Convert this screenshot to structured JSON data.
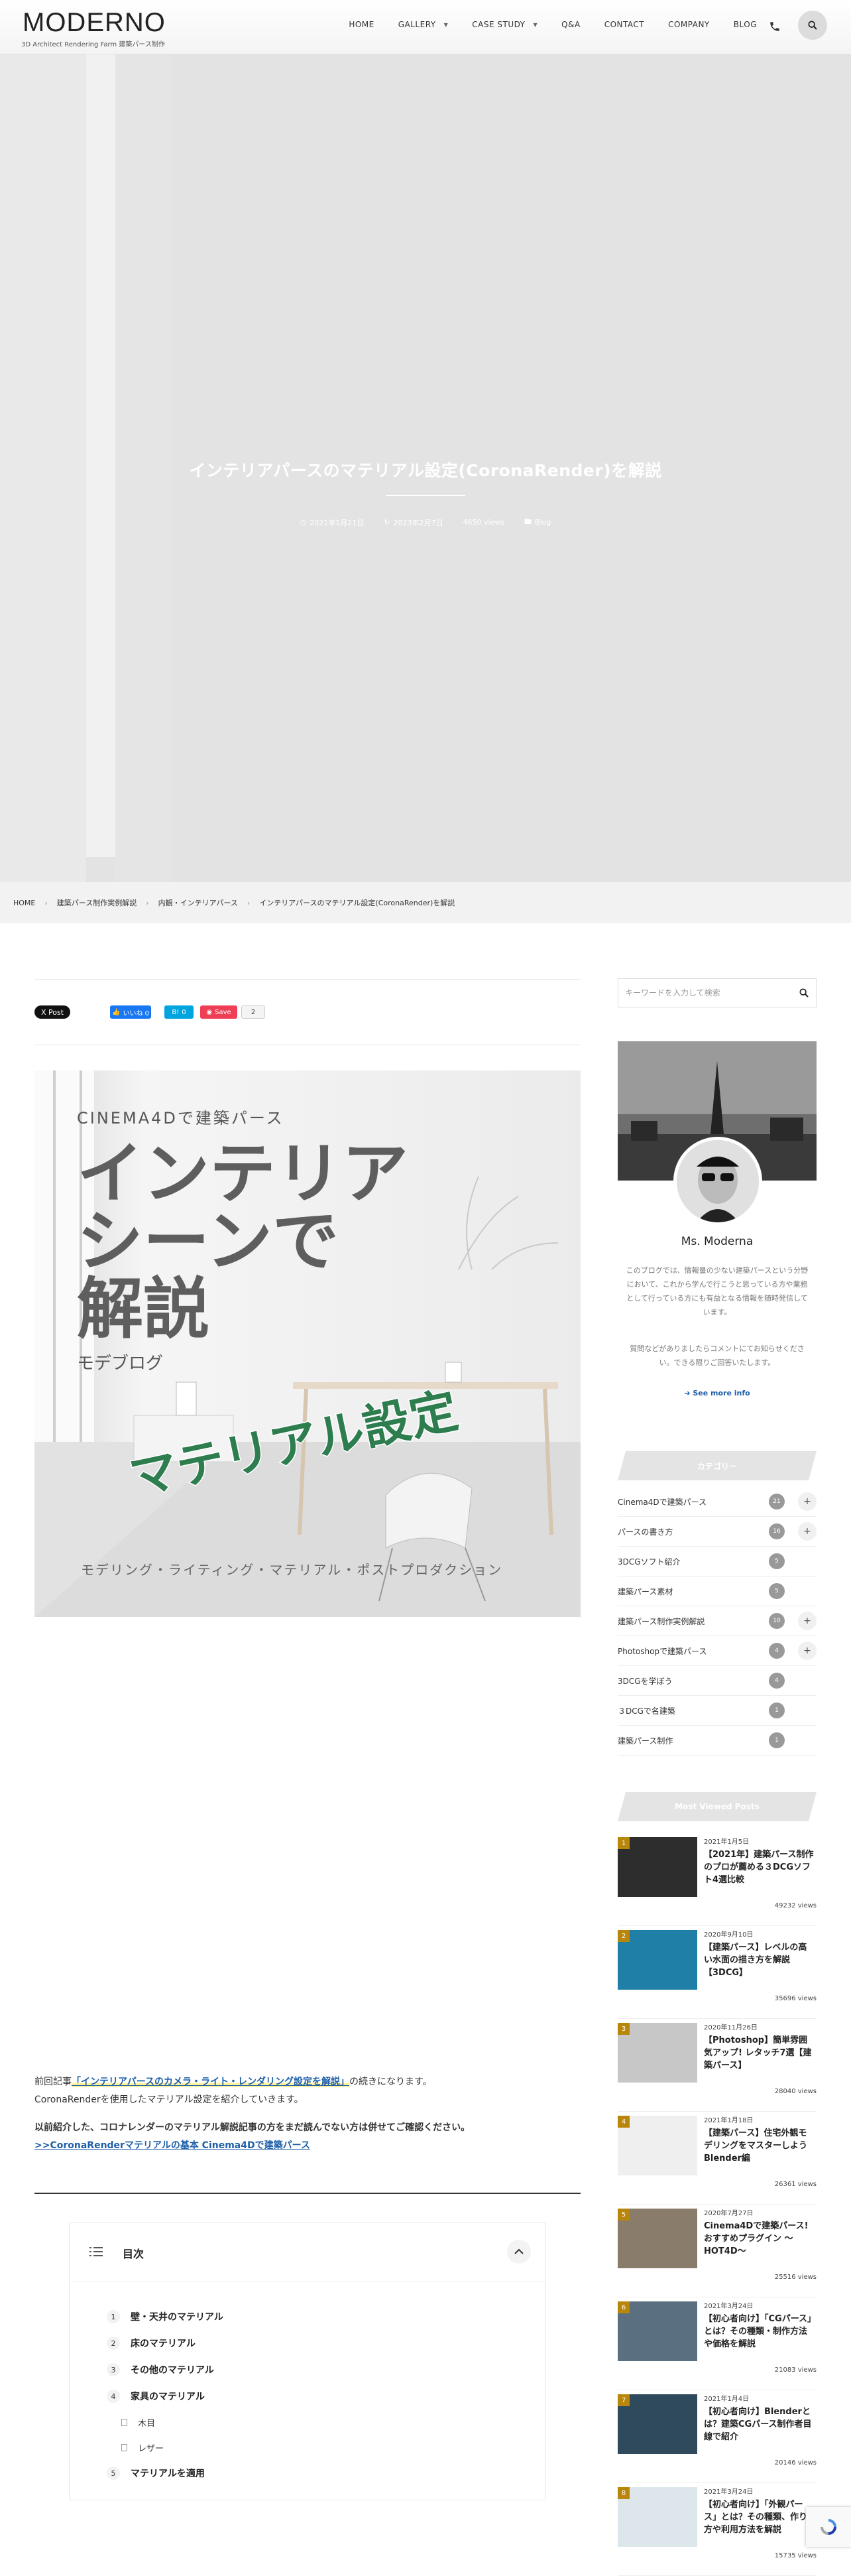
{
  "header": {
    "logo": "MODERNO",
    "tagline": "3D Architect Rendering Farm 建築パース制作",
    "nav": [
      {
        "label": "HOME",
        "dropdown": false
      },
      {
        "label": "GALLERY",
        "dropdown": true
      },
      {
        "label": "CASE STUDY",
        "dropdown": true
      },
      {
        "label": "Q&A",
        "dropdown": false
      },
      {
        "label": "CONTACT",
        "dropdown": false
      },
      {
        "label": "COMPANY",
        "dropdown": false
      },
      {
        "label": "BLOG",
        "dropdown": false
      }
    ]
  },
  "hero": {
    "title": "インテリアパースのマテリアル設定(CoronaRender)を解説",
    "published": "2021年1月21日",
    "updated": "2023年2月7日",
    "views": "4650 views",
    "category": "Blog"
  },
  "breadcrumb": [
    "HOME",
    "建築パース制作実例解説",
    "内観・インテリアパース",
    "インテリアパースのマテリアル設定(CoronaRender)を解説"
  ],
  "share": {
    "x_label": "X Post",
    "fb_label": "いいね 0",
    "hatena_count": "0",
    "pocket_label": "Save",
    "pocket_count": "2"
  },
  "eyecatch": {
    "line1": "CINEMA4Dで建築パース",
    "big1": "インテリア",
    "big2": "シーンで",
    "big3": "解説",
    "sub": "モデブログ",
    "slanted": "マテリアル設定",
    "bottom": "モデリング・ライティング・マテリアル・ポストプロダクション"
  },
  "intro": {
    "p1_pre": "前回記事",
    "p1_link": "「インテリアパースのカメラ・ライト・レンダリング設定を解説」",
    "p1_post": "の続きになります。",
    "p1_line2": "CoronaRenderを使用したマテリアル設定を紹介していきます。",
    "p2": "以前紹介した、コロナレンダーのマテリアル解説記事の方をまだ読んでない方は併せてご確認ください。",
    "p2_link": ">>CoronaRenderマテリアルの基本 Cinema4Dで建築パース"
  },
  "toc": {
    "title": "目次",
    "items": [
      {
        "num": "1",
        "label": "壁・天井のマテリアル"
      },
      {
        "num": "2",
        "label": "床のマテリアル"
      },
      {
        "num": "3",
        "label": "その他のマテリアル"
      },
      {
        "num": "4",
        "label": "家具のマテリアル"
      }
    ],
    "subitems": [
      "木目",
      "レザー"
    ],
    "last": {
      "num": "5",
      "label": "マテリアルを適用"
    }
  },
  "sidebar": {
    "search_placeholder": "キーワードを入力して検索",
    "profile_name": "Ms. Moderna",
    "profile_desc": "このブログでは、情報量の少ない建築パースという分野において、これから学んで行こうと思っている方や業務として行っている方にも有益となる情報を随時発信しています。",
    "profile_desc2": "質問などがありましたらコメントにてお知らせください。できる限りご回答いたします。",
    "see_more": "See more info",
    "categories_title": "カテゴリー",
    "categories": [
      {
        "label": "Cinema4Dで建築パース",
        "count": "21",
        "expand": true
      },
      {
        "label": "パースの書き方",
        "count": "16",
        "expand": true
      },
      {
        "label": "3DCGソフト紹介",
        "count": "5",
        "expand": false
      },
      {
        "label": "建築パース素材",
        "count": "5",
        "expand": false
      },
      {
        "label": "建築パース制作実例解説",
        "count": "10",
        "expand": true
      },
      {
        "label": "Photoshopで建築パース",
        "count": "4",
        "expand": true
      },
      {
        "label": "3DCGを学ぼう",
        "count": "4",
        "expand": false
      },
      {
        "label": "３DCGで名建築",
        "count": "1",
        "expand": false
      },
      {
        "label": "建築パース制作",
        "count": "1",
        "expand": false
      }
    ],
    "popular_title": "Most Viewed Posts",
    "popular": [
      {
        "rank": "1",
        "date": "2021年1月5日",
        "title": "【2021年】建築パース制作のプロが薦める３DCGソフト4選比較",
        "views": "49232 views"
      },
      {
        "rank": "2",
        "date": "2020年9月10日",
        "title": "【建築パース】レベルの高い水面の描き方を解説【3DCG】",
        "views": "35696 views"
      },
      {
        "rank": "3",
        "date": "2020年11月26日",
        "title": "【Photoshop】簡単雰囲気アップ! レタッチ7選【建築パース】",
        "views": "28040 views"
      },
      {
        "rank": "4",
        "date": "2021年1月18日",
        "title": "【建築パース】住宅外観モデリングをマスターしよう Blender編",
        "views": "26361 views"
      },
      {
        "rank": "5",
        "date": "2020年7月27日",
        "title": "Cinema4Dで建築パース! おすすめプラグイン 〜HOT4D〜",
        "views": "25516 views"
      },
      {
        "rank": "6",
        "date": "2021年3月24日",
        "title": "【初心者向け】「CGパース」とは？その種類・制作方法や価格を解説",
        "views": "21083 views"
      },
      {
        "rank": "7",
        "date": "2021年1月4日",
        "title": "【初心者向け】Blenderとは？建築CGパース制作者目線で紹介",
        "views": "20146 views"
      },
      {
        "rank": "8",
        "date": "2021年3月24日",
        "title": "【初心者向け】「外観パース」とは？その種類、作り方や利用方法を解説",
        "views": "15735 views"
      }
    ]
  },
  "colors": {
    "accent": "#1e5fa8",
    "brand_green": "#2e7d4f",
    "fb": "#1877f2",
    "hatena": "#00a4de",
    "pocket": "#ef3f56"
  }
}
